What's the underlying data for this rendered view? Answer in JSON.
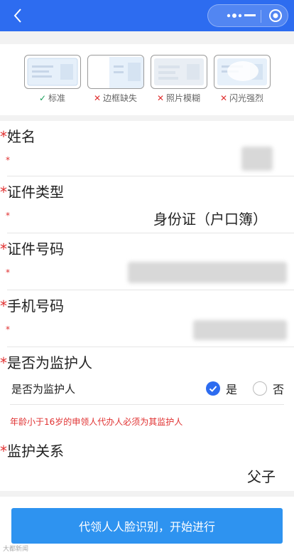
{
  "samples": [
    {
      "status": "ok",
      "mark": "✓",
      "label": "标准"
    },
    {
      "status": "bad",
      "mark": "✕",
      "label": "边框缺失"
    },
    {
      "status": "bad",
      "mark": "✕",
      "label": "照片模糊"
    },
    {
      "status": "bad",
      "mark": "✕",
      "label": "闪光强烈"
    }
  ],
  "form": {
    "name_label": "姓名",
    "idtype_label": "证件类型",
    "idtype_value": "身份证（户口簿）",
    "idno_label": "证件号码",
    "phone_label": "手机号码",
    "guardian_label": "是否为监护人",
    "guardian_question": "是否为监护人",
    "yes_label": "是",
    "no_label": "否",
    "guardian_selected": "是",
    "warning": "年龄小于16岁的申领人代办人必须为其监护人",
    "relation_label": "监护关系",
    "relation_value": "父子",
    "required_mark": "*",
    "small_mark": "*"
  },
  "cta_label": "代领人人脸识别，开始进行",
  "watermark": "大都新闻",
  "colors": {
    "brand": "#2d6cf0",
    "cta": "#2e93f0",
    "required": "#e03030"
  }
}
